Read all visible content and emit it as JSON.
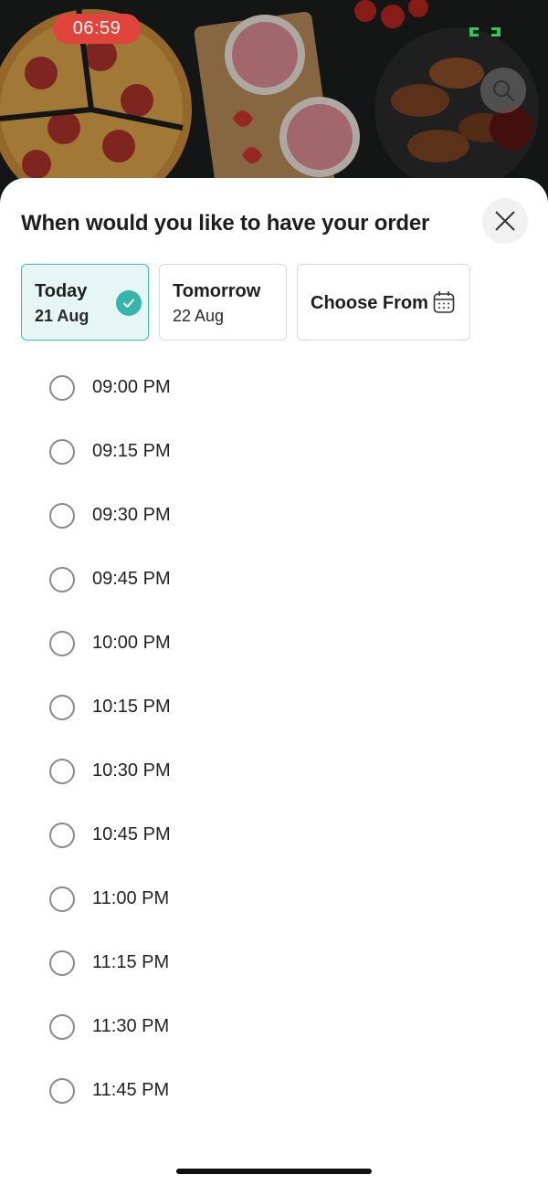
{
  "status": {
    "time": "06:59"
  },
  "sheet": {
    "title": "When would you like to have your order",
    "dates": [
      {
        "day": "Today",
        "date": "21 Aug",
        "selected": true
      },
      {
        "day": "Tomorrow",
        "date": "22 Aug",
        "selected": false
      }
    ],
    "choose_label": "Choose From",
    "slots": [
      "09:00 PM",
      "09:15 PM",
      "09:30 PM",
      "09:45 PM",
      "10:00 PM",
      "10:15 PM",
      "10:30 PM",
      "10:45 PM",
      "11:00 PM",
      "11:15 PM",
      "11:30 PM",
      "11:45 PM"
    ]
  },
  "colors": {
    "accent": "#36b5ab",
    "selected_bg": "#e6f6f4",
    "time_pill": "#e0443a"
  }
}
